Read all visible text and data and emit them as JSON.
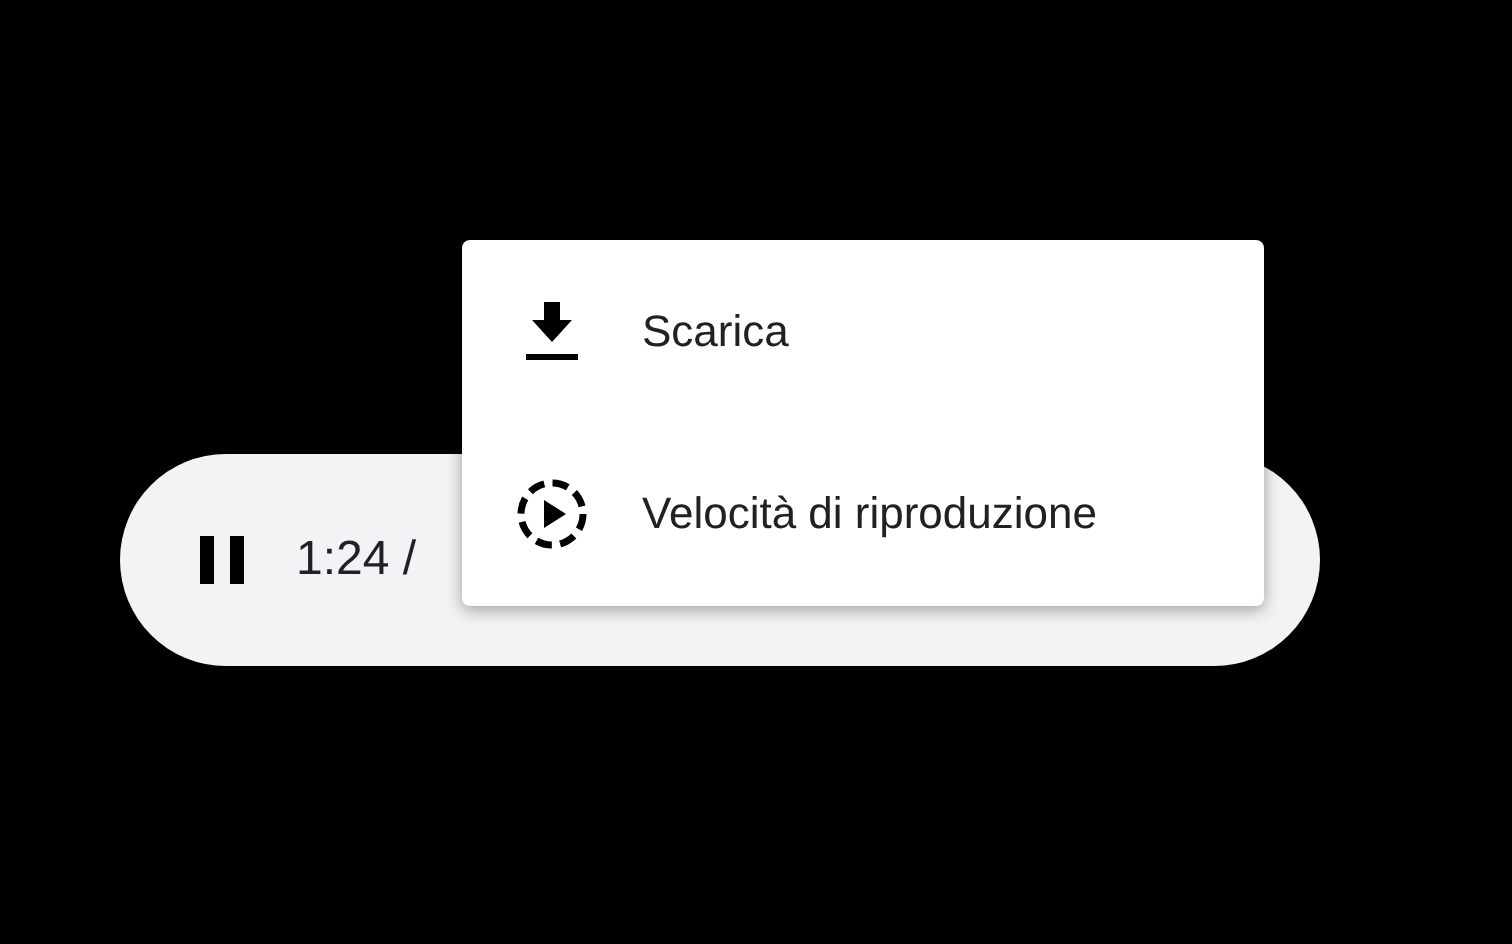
{
  "player": {
    "playing": true,
    "time": "1:24 /"
  },
  "menu": {
    "items": [
      {
        "kind": "download",
        "label": "Scarica"
      },
      {
        "kind": "speed",
        "label": "Velocità di riproduzione"
      }
    ]
  }
}
